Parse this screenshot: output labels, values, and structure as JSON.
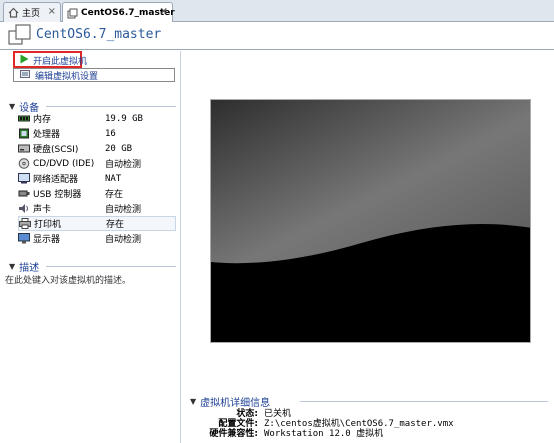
{
  "tabs": [
    {
      "label": "主页",
      "icon": "home-icon",
      "active": false
    },
    {
      "label": "CentOS6.7_master",
      "icon": "vm-icon",
      "active": true
    }
  ],
  "vm": {
    "title": "CentOS6.7_master"
  },
  "actions": {
    "start": "开启此虚拟机",
    "edit": "编辑虚拟机设置"
  },
  "devices": {
    "header": "设备",
    "items": [
      {
        "name": "内存",
        "value": "19.9 GB",
        "icon": "memory-icon"
      },
      {
        "name": "处理器",
        "value": "16",
        "icon": "cpu-icon"
      },
      {
        "name": "硬盘(SCSI)",
        "value": "20 GB",
        "icon": "hdd-icon"
      },
      {
        "name": "CD/DVD (IDE)",
        "value": "自动检测",
        "icon": "cdrom-icon"
      },
      {
        "name": "网络适配器",
        "value": "NAT",
        "icon": "network-icon"
      },
      {
        "name": "USB 控制器",
        "value": "存在",
        "icon": "usb-icon"
      },
      {
        "name": "声卡",
        "value": "自动检测",
        "icon": "sound-icon"
      },
      {
        "name": "打印机",
        "value": "存在",
        "icon": "printer-icon"
      },
      {
        "name": "显示器",
        "value": "自动检测",
        "icon": "display-icon"
      }
    ]
  },
  "description": {
    "header": "描述",
    "placeholder": "在此处键入对该虚拟机的描述。"
  },
  "details": {
    "header": "虚拟机详细信息",
    "rows": [
      {
        "key": "状态:",
        "value": "已关机"
      },
      {
        "key": "配置文件:",
        "value": "Z:\\centos虚拟机\\CentOS6.7_master.vmx"
      },
      {
        "key": "硬件兼容性:",
        "value": "Workstation 12.0 虚拟机"
      }
    ]
  },
  "colors": {
    "link": "#1c3f94",
    "highlight_border": "#e02828",
    "play": "#2aa02a"
  }
}
